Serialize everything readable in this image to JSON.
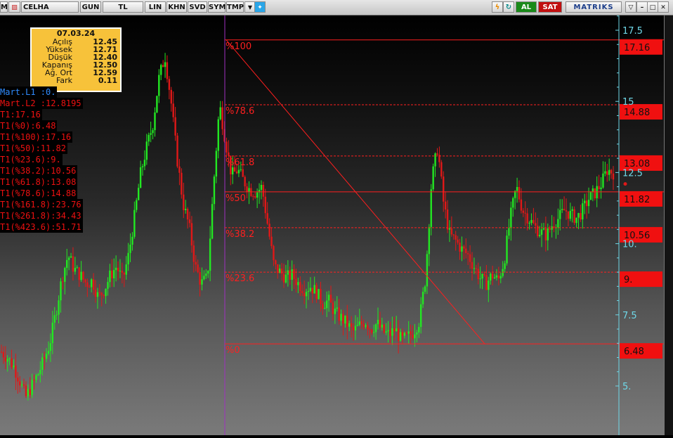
{
  "toolbar": {
    "symbol": "CELHA",
    "buttons": [
      "GUN",
      "TL",
      "LIN",
      "KHN",
      "SVD",
      "SYM",
      "TMP"
    ],
    "al_label": "AL",
    "sat_label": "SAT",
    "brand": "MATRIKS"
  },
  "info_box": {
    "date": "07.03.24",
    "rows": [
      {
        "label": "Açılış",
        "value": "12.45"
      },
      {
        "label": "Yüksek",
        "value": "12.71"
      },
      {
        "label": "Düşük",
        "value": "12.40"
      },
      {
        "label": "Kapanış",
        "value": "12.50"
      },
      {
        "label": "Ağ. Ort",
        "value": "12.59"
      },
      {
        "label": "Fark",
        "value": "0.11"
      }
    ]
  },
  "indicators": [
    {
      "text": "Mart.L1        :0.",
      "color": "#2f8cff"
    },
    {
      "text": "Mart.L2        :12.8195",
      "color": "#e11"
    },
    {
      "text": "T1:17.16",
      "color": "#e11"
    },
    {
      "text": "T1(%0):6.48",
      "color": "#e11"
    },
    {
      "text": "T1(%100):17.16",
      "color": "#e11"
    },
    {
      "text": "T1(%50):11.82",
      "color": "#e11"
    },
    {
      "text": "T1(%23.6):9.",
      "color": "#e11"
    },
    {
      "text": "T1(%38.2):10.56",
      "color": "#e11"
    },
    {
      "text": "T1(%61.8):13.08",
      "color": "#e11"
    },
    {
      "text": "T1(%78.6):14.88",
      "color": "#e11"
    },
    {
      "text": "T1(%161.8):23.76",
      "color": "#e11"
    },
    {
      "text": "T1(%261.8):34.43",
      "color": "#e11"
    },
    {
      "text": "T1(%423.6):51.71",
      "color": "#e11"
    }
  ],
  "chart_data": {
    "type": "candlestick",
    "y_axis_ticks": [
      "17.5",
      "15",
      "12.5",
      "10.",
      "7.5",
      "5."
    ],
    "fib_levels": [
      {
        "label": "%100",
        "value": "17.16",
        "style": "solid"
      },
      {
        "label": "%78.6",
        "value": "14.88",
        "style": "dashed"
      },
      {
        "label": "%61.8",
        "value": "13.08",
        "style": "dashed"
      },
      {
        "label": "%50",
        "value": "11.82",
        "style": "solid"
      },
      {
        "label": "%38.2",
        "value": "10.56",
        "style": "dashed"
      },
      {
        "label": "%23.6",
        "value": "9.",
        "style": "dashed"
      },
      {
        "label": "%0",
        "value": "6.48",
        "style": "solid"
      }
    ],
    "price_path": [
      6.2,
      6.0,
      5.7,
      5.2,
      4.6,
      5.0,
      5.4,
      5.9,
      6.5,
      7.6,
      8.8,
      9.6,
      9.1,
      8.9,
      8.6,
      8.7,
      8.1,
      8.4,
      8.9,
      9.2,
      8.7,
      9.6,
      11.0,
      12.5,
      13.4,
      14.2,
      15.8,
      16.6,
      15.0,
      13.0,
      11.4,
      10.6,
      9.2,
      8.6,
      8.8,
      12.0,
      14.9,
      13.6,
      12.4,
      12.6,
      12.2,
      11.9,
      11.8,
      12.0,
      10.6,
      9.2,
      9.0,
      8.8,
      8.9,
      8.6,
      8.4,
      8.5,
      8.3,
      7.9,
      8.0,
      7.6,
      7.4,
      7.2,
      6.9,
      7.1,
      7.3,
      7.0,
      7.2,
      6.9,
      6.8,
      7.0,
      6.6,
      6.7,
      6.9,
      7.3,
      8.8,
      12.2,
      13.4,
      11.4,
      10.3,
      10.1,
      9.8,
      9.6,
      9.2,
      8.8,
      8.6,
      8.9,
      8.7,
      9.4,
      10.9,
      12.0,
      11.2,
      10.9,
      10.6,
      10.4,
      10.3,
      10.7,
      10.9,
      11.2,
      11.0,
      10.9,
      11.2,
      11.6,
      11.8,
      12.1,
      12.6,
      12.5
    ],
    "ylim": [
      3.5,
      18.5
    ]
  },
  "colors": {
    "up": "#22e822",
    "down": "#e01818",
    "fib_line": "#ff1f1f",
    "axis_text": "#6fd8e8",
    "accent": "#f7c23a"
  }
}
